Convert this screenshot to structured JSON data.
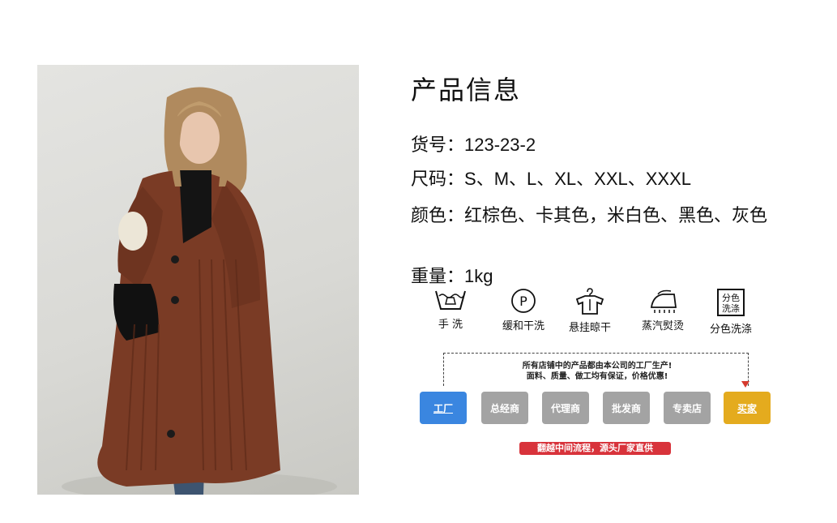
{
  "product": {
    "title": "产品信息",
    "item_no_label": "货号：",
    "item_no": "123-23-2",
    "size_label": "尺码：",
    "sizes": "S、M、L、XL、XXL、XXXL",
    "color_label": "颜色：",
    "colors": "红棕色、卡其色，米白色、黑色、灰色",
    "weight_label": "重量：",
    "weight": "1kg"
  },
  "care": [
    {
      "icon": "hand-wash-icon",
      "label": "手  洗"
    },
    {
      "icon": "dry-clean-icon",
      "label": "缓和干洗",
      "glyph": "P"
    },
    {
      "icon": "hang-dry-icon",
      "label": "悬挂晾干"
    },
    {
      "icon": "steam-iron-icon",
      "label": "蒸汽熨烫"
    },
    {
      "icon": "separate-wash-icon",
      "label": "分色洗涤",
      "glyph": "分色洗涤"
    }
  ],
  "supply_chain": {
    "note_line1": "所有店铺中的产品都由本公司的工厂生产!",
    "note_line2": "面料、质量、做工均有保证，价格优惠!",
    "steps": [
      "工厂",
      "总经商",
      "代理商",
      "批发商",
      "专卖店",
      "买家"
    ],
    "banner": "翻越中间流程，源头厂家直供",
    "colors": {
      "factory": "#3a86e0",
      "middle": "#a3a3a3",
      "buyer": "#e4ab1e",
      "banner": "#d8333b"
    }
  }
}
